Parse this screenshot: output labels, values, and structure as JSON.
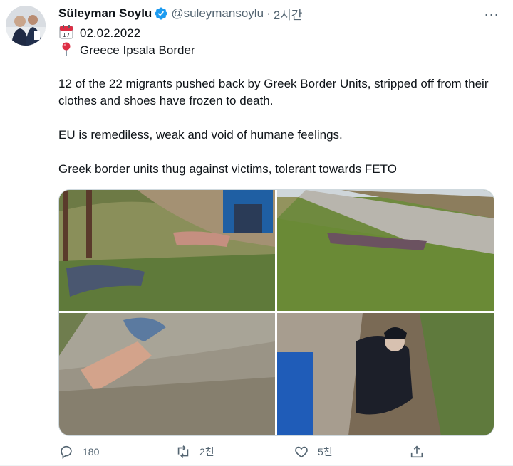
{
  "tweet": {
    "author_name": "Süleyman Soylu",
    "handle": "@suleymansoylu",
    "separator": "·",
    "time": "2시간",
    "date_line": "02.02.2022",
    "location_line": "Greece Ipsala Border",
    "paragraphs": [
      "12 of the 22 migrants pushed back by Greek Border Units, stripped off from their clothes and shoes have frozen to death.",
      "EU is remediless, weak and void of humane feelings.",
      "Greek border units thug against victims, tolerant towards FETO"
    ],
    "more_label": "···"
  },
  "actions": {
    "reply_count": "180",
    "retweet_count": "2천",
    "like_count": "5천"
  },
  "icons": {
    "verified": "verified-badge-icon",
    "calendar": "calendar-emoji-icon",
    "pin": "round-pushpin-emoji-icon",
    "reply": "reply-icon",
    "retweet": "retweet-icon",
    "like": "heart-icon",
    "share": "share-icon"
  },
  "colors": {
    "verified": "#1d9bf0",
    "secondary_text": "#536471",
    "primary_text": "#0f1419"
  }
}
